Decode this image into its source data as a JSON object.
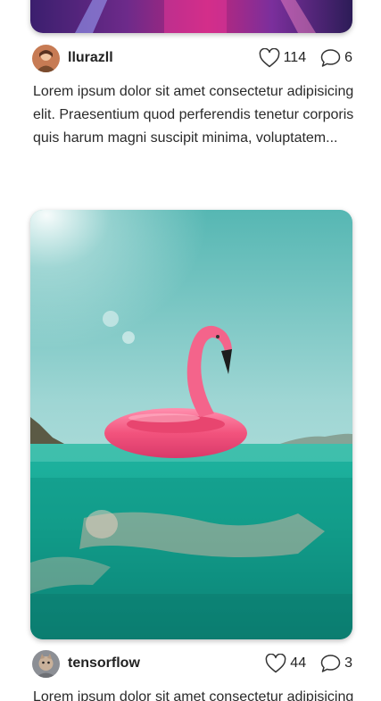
{
  "posts": [
    {
      "username": "llurazll",
      "likes": "114",
      "comments": "6",
      "description": "Lorem ipsum dolor sit amet consectetur adipisicing elit. Praesentium quod perferendis tenetur corporis quis harum magni suscipit minima, voluptatem..."
    },
    {
      "username": "tensorflow",
      "likes": "44",
      "comments": "3",
      "description": "Lorem ipsum dolor sit amet consectetur adipisicing elit."
    }
  ],
  "icons": {
    "like": "heart-outline-icon",
    "comment": "speech-bubble-outline-icon"
  },
  "colors": {
    "text": "#222222",
    "flamingo_pink": "#f2537d",
    "sea": "#1fb3a0",
    "sky": "#a8dde0"
  }
}
